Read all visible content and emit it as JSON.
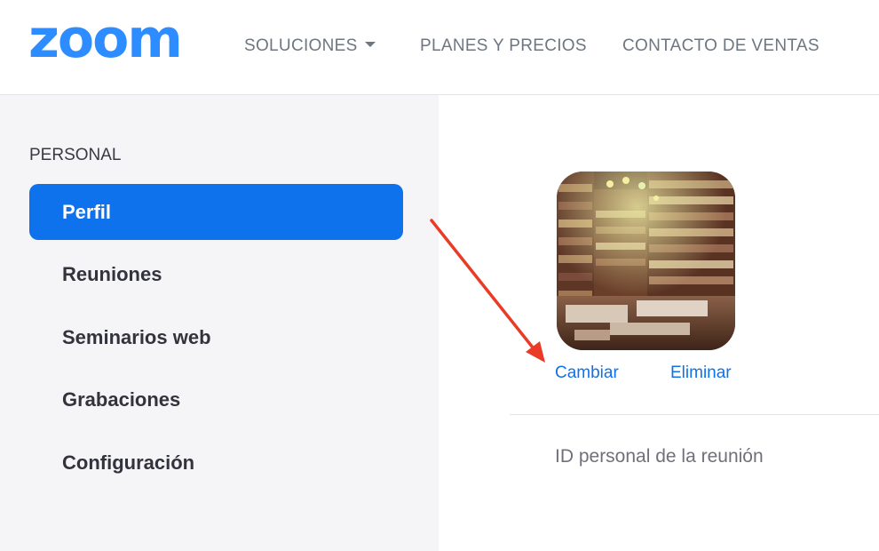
{
  "header": {
    "logo": "zoom",
    "nav": [
      {
        "label": "SOLUCIONES",
        "has_dropdown": true
      },
      {
        "label": "PLANES Y PRECIOS"
      },
      {
        "label": "CONTACTO DE VENTAS"
      }
    ]
  },
  "sidebar": {
    "section": "PERSONAL",
    "items": [
      {
        "label": "Perfil",
        "active": true
      },
      {
        "label": "Reuniones"
      },
      {
        "label": "Seminarios web"
      },
      {
        "label": "Grabaciones"
      },
      {
        "label": "Configuración"
      }
    ]
  },
  "profile": {
    "change_label": "Cambiar",
    "delete_label": "Eliminar",
    "pmi_label": "ID personal de la reunión"
  },
  "colors": {
    "brand": "#2d8cff",
    "active": "#0e72ed",
    "annotation_arrow": "#ea3b26"
  }
}
